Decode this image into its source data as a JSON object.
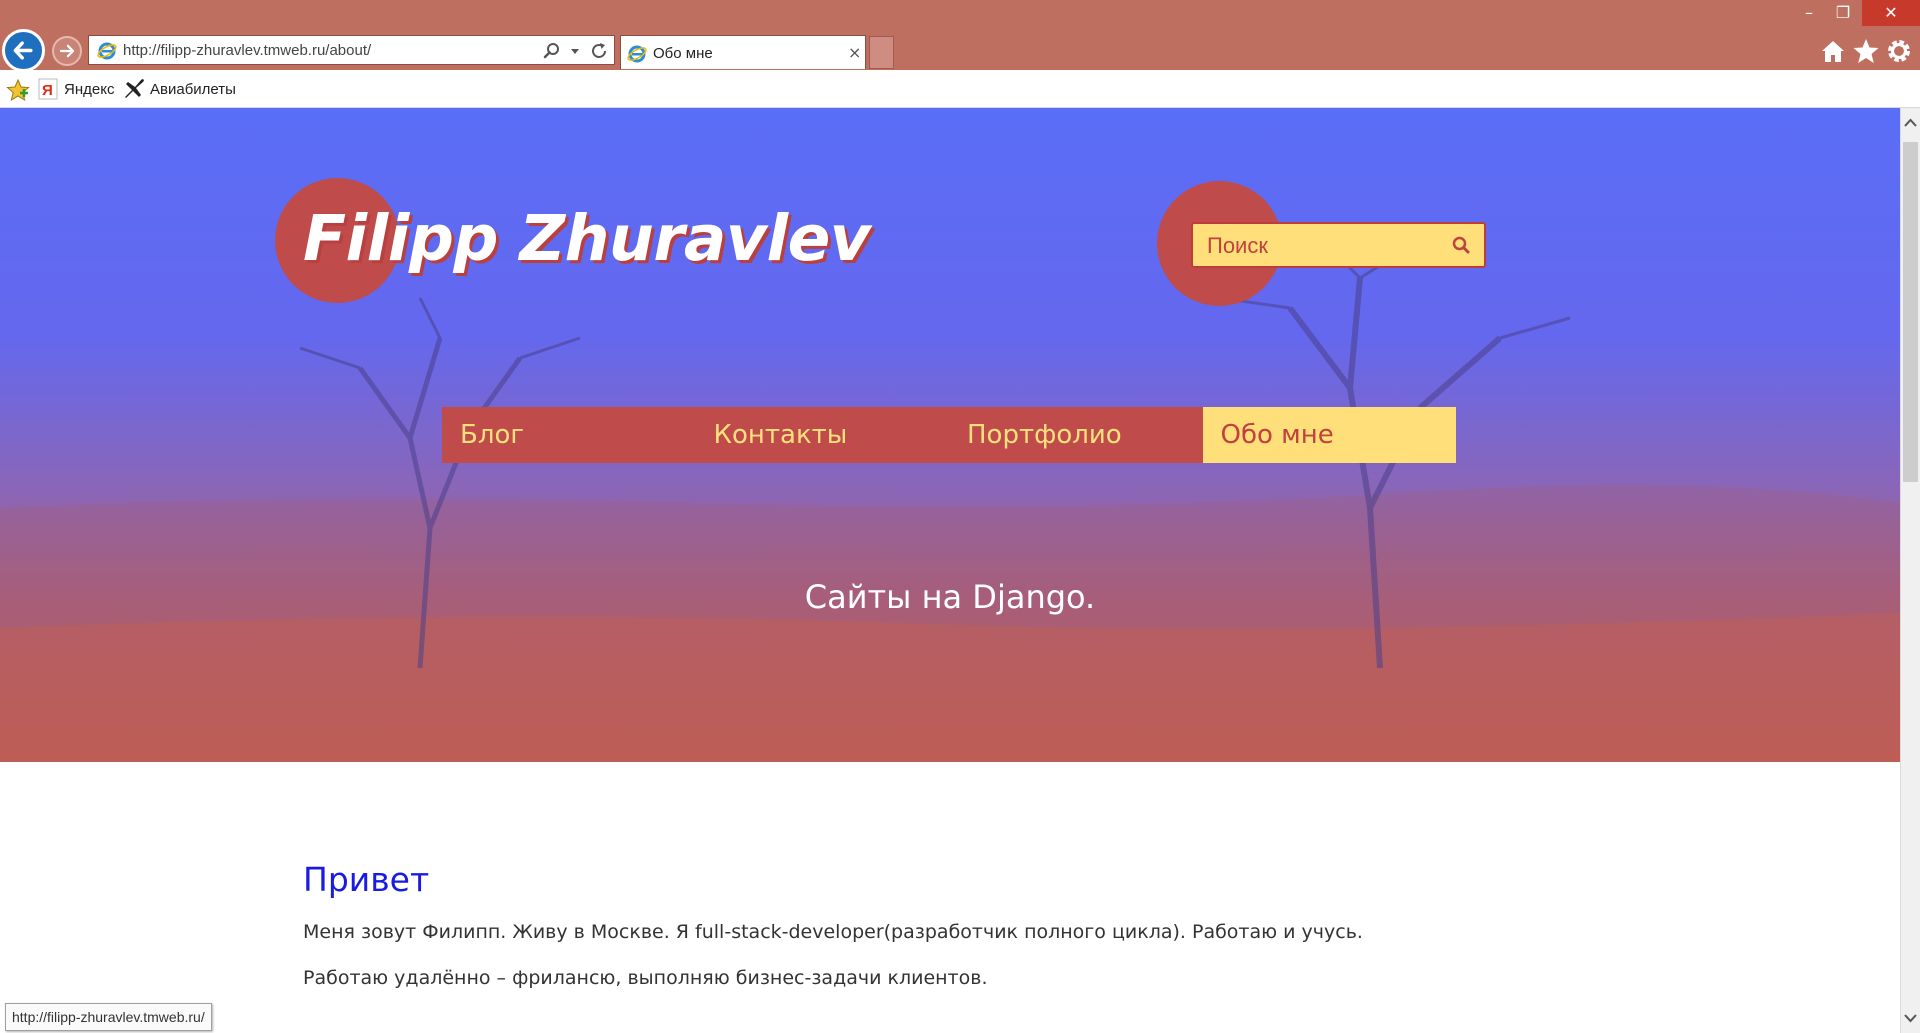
{
  "browser": {
    "url": "http://filipp-zhuravlev.tmweb.ru/about/",
    "tab_title": "Обо мне",
    "tab_close": "×",
    "window_controls": {
      "minimize": "–",
      "maximize": "❐",
      "close": "✕"
    },
    "favorites": [
      {
        "label": "Яндекс",
        "icon": "yandex-icon"
      },
      {
        "label": "Авиабилеты",
        "icon": "plane-icon"
      }
    ],
    "status_url": "http://filipp-zhuravlev.tmweb.ru/"
  },
  "site": {
    "logo": "Filipp Zhuravlev",
    "search_placeholder": "Поиск",
    "nav": [
      {
        "label": "Блог",
        "active": false
      },
      {
        "label": "Контакты",
        "active": false
      },
      {
        "label": "Портфолио",
        "active": false
      },
      {
        "label": "Обо мне",
        "active": true
      }
    ],
    "tagline": "Сайты на Django.",
    "greeting": "Привет",
    "paragraphs": [
      "Меня зовут Филипп.  Живу в Москве.  Я full-stack-developer(разработчик полного цикла).  Работаю и учусь.",
      "Работаю удалённо – фрилансю, выполняю бизнес-задачи клиентов."
    ]
  },
  "colors": {
    "accent_red": "#bf4b4b",
    "accent_yellow": "#ffdf7a",
    "heading_blue": "#1a1ae0"
  }
}
